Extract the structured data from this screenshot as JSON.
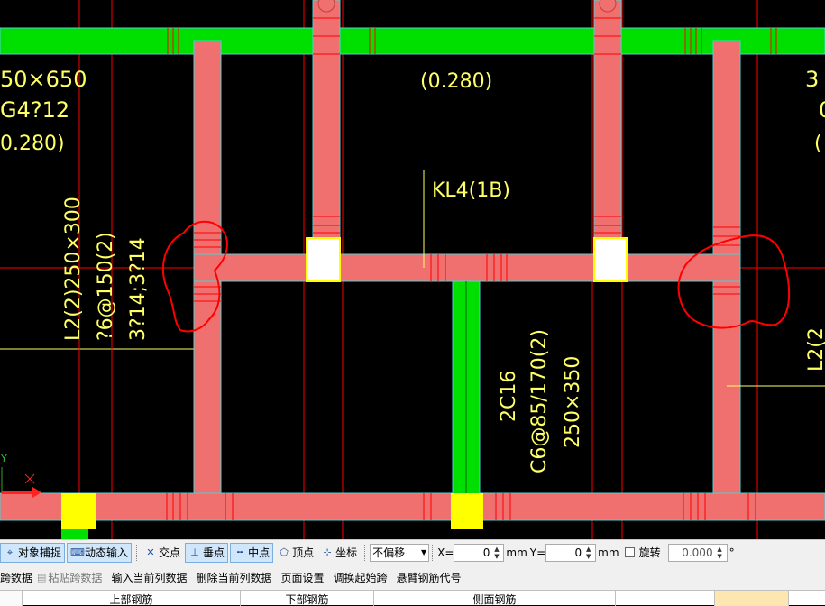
{
  "drawing": {
    "labels": {
      "left_size": "50×650",
      "left_rebar": "G4?12",
      "left_coef": "0.280)",
      "top_coef": "(0.280)",
      "right_frag_1": "3",
      "right_frag_2": "0",
      "right_frag_3": "(",
      "beam_name": "KL4(1B)",
      "l2_name": "L2(2)250×300",
      "l2_stirrup": "?6@150(2)",
      "l2_rebar": "3?14;3?14",
      "mid_rebar": "2C16",
      "mid_stirrup": "C6@85/170(2)",
      "mid_size": "250×350",
      "right_vertical": "L2(2",
      "ucs_y": "Y"
    },
    "colors": {
      "beam_fill": "#f07070",
      "beam_edge": "#4fd0d0",
      "green_beam": "#00e000",
      "axis": "#ff0000",
      "text": "#ffff66",
      "column_white": "#ffffff",
      "column_yellow": "#ffff00",
      "markup": "#ff0000"
    }
  },
  "snapbar": {
    "object_snap": "对象捕捉",
    "dynamic_input": "动态输入",
    "intersection": "交点",
    "perpendicular": "垂点",
    "midpoint": "中点",
    "vertex": "顶点",
    "coordinate": "坐标",
    "offset_mode": "不偏移",
    "x_label": "X=",
    "x_value": "0",
    "x_unit": "mm",
    "y_label": "Y=",
    "y_value": "0",
    "y_unit": "mm",
    "rotate_label": "旋转",
    "rotate_value": "0.000",
    "degree": "°"
  },
  "menubar": {
    "items": [
      {
        "label": "跨数据",
        "disabled": false
      },
      {
        "label": "粘贴跨数据",
        "disabled": true
      },
      {
        "label": "输入当前列数据",
        "disabled": false
      },
      {
        "label": "删除当前列数据",
        "disabled": false
      },
      {
        "label": "页面设置",
        "disabled": false
      },
      {
        "label": "调换起始跨",
        "disabled": false
      },
      {
        "label": "悬臂钢筋代号",
        "disabled": false
      }
    ]
  },
  "table": {
    "headers": [
      "上部钢筋",
      "下部钢筋",
      "侧面钢筋"
    ]
  }
}
